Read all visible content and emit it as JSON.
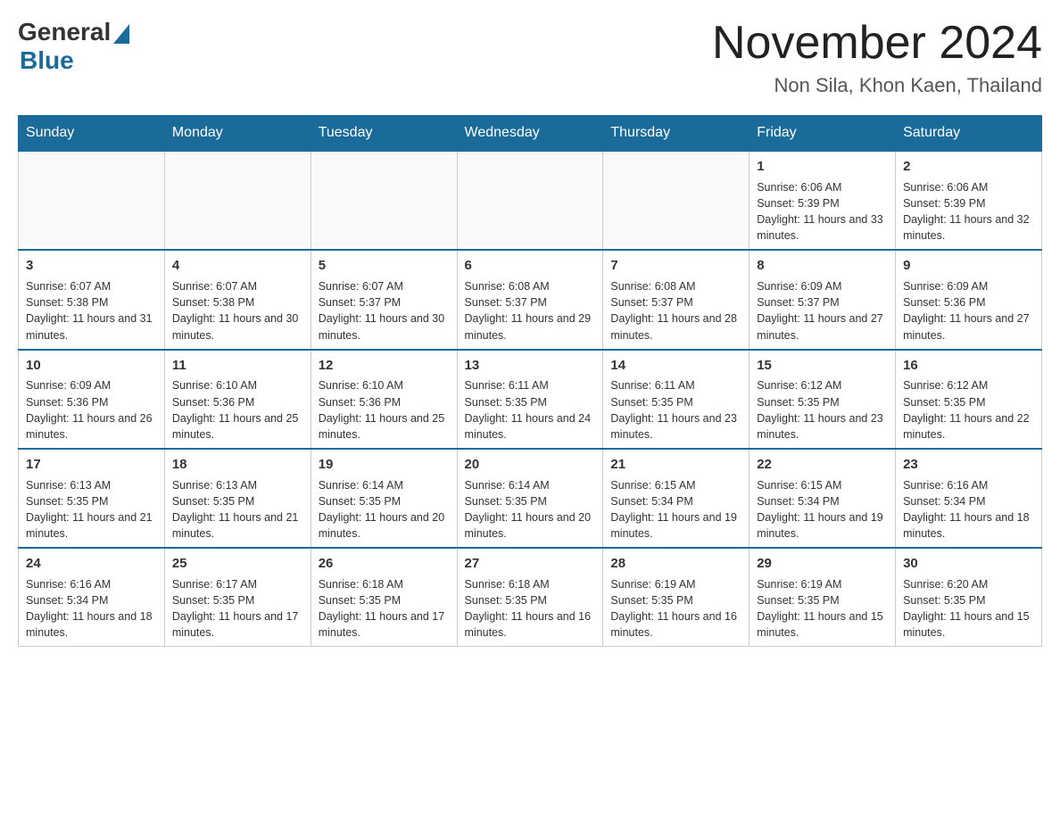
{
  "logo": {
    "general": "General",
    "blue": "Blue"
  },
  "title": "November 2024",
  "subtitle": "Non Sila, Khon Kaen, Thailand",
  "weekdays": [
    "Sunday",
    "Monday",
    "Tuesday",
    "Wednesday",
    "Thursday",
    "Friday",
    "Saturday"
  ],
  "weeks": [
    [
      {
        "day": "",
        "info": ""
      },
      {
        "day": "",
        "info": ""
      },
      {
        "day": "",
        "info": ""
      },
      {
        "day": "",
        "info": ""
      },
      {
        "day": "",
        "info": ""
      },
      {
        "day": "1",
        "info": "Sunrise: 6:06 AM\nSunset: 5:39 PM\nDaylight: 11 hours and 33 minutes."
      },
      {
        "day": "2",
        "info": "Sunrise: 6:06 AM\nSunset: 5:39 PM\nDaylight: 11 hours and 32 minutes."
      }
    ],
    [
      {
        "day": "3",
        "info": "Sunrise: 6:07 AM\nSunset: 5:38 PM\nDaylight: 11 hours and 31 minutes."
      },
      {
        "day": "4",
        "info": "Sunrise: 6:07 AM\nSunset: 5:38 PM\nDaylight: 11 hours and 30 minutes."
      },
      {
        "day": "5",
        "info": "Sunrise: 6:07 AM\nSunset: 5:37 PM\nDaylight: 11 hours and 30 minutes."
      },
      {
        "day": "6",
        "info": "Sunrise: 6:08 AM\nSunset: 5:37 PM\nDaylight: 11 hours and 29 minutes."
      },
      {
        "day": "7",
        "info": "Sunrise: 6:08 AM\nSunset: 5:37 PM\nDaylight: 11 hours and 28 minutes."
      },
      {
        "day": "8",
        "info": "Sunrise: 6:09 AM\nSunset: 5:37 PM\nDaylight: 11 hours and 27 minutes."
      },
      {
        "day": "9",
        "info": "Sunrise: 6:09 AM\nSunset: 5:36 PM\nDaylight: 11 hours and 27 minutes."
      }
    ],
    [
      {
        "day": "10",
        "info": "Sunrise: 6:09 AM\nSunset: 5:36 PM\nDaylight: 11 hours and 26 minutes."
      },
      {
        "day": "11",
        "info": "Sunrise: 6:10 AM\nSunset: 5:36 PM\nDaylight: 11 hours and 25 minutes."
      },
      {
        "day": "12",
        "info": "Sunrise: 6:10 AM\nSunset: 5:36 PM\nDaylight: 11 hours and 25 minutes."
      },
      {
        "day": "13",
        "info": "Sunrise: 6:11 AM\nSunset: 5:35 PM\nDaylight: 11 hours and 24 minutes."
      },
      {
        "day": "14",
        "info": "Sunrise: 6:11 AM\nSunset: 5:35 PM\nDaylight: 11 hours and 23 minutes."
      },
      {
        "day": "15",
        "info": "Sunrise: 6:12 AM\nSunset: 5:35 PM\nDaylight: 11 hours and 23 minutes."
      },
      {
        "day": "16",
        "info": "Sunrise: 6:12 AM\nSunset: 5:35 PM\nDaylight: 11 hours and 22 minutes."
      }
    ],
    [
      {
        "day": "17",
        "info": "Sunrise: 6:13 AM\nSunset: 5:35 PM\nDaylight: 11 hours and 21 minutes."
      },
      {
        "day": "18",
        "info": "Sunrise: 6:13 AM\nSunset: 5:35 PM\nDaylight: 11 hours and 21 minutes."
      },
      {
        "day": "19",
        "info": "Sunrise: 6:14 AM\nSunset: 5:35 PM\nDaylight: 11 hours and 20 minutes."
      },
      {
        "day": "20",
        "info": "Sunrise: 6:14 AM\nSunset: 5:35 PM\nDaylight: 11 hours and 20 minutes."
      },
      {
        "day": "21",
        "info": "Sunrise: 6:15 AM\nSunset: 5:34 PM\nDaylight: 11 hours and 19 minutes."
      },
      {
        "day": "22",
        "info": "Sunrise: 6:15 AM\nSunset: 5:34 PM\nDaylight: 11 hours and 19 minutes."
      },
      {
        "day": "23",
        "info": "Sunrise: 6:16 AM\nSunset: 5:34 PM\nDaylight: 11 hours and 18 minutes."
      }
    ],
    [
      {
        "day": "24",
        "info": "Sunrise: 6:16 AM\nSunset: 5:34 PM\nDaylight: 11 hours and 18 minutes."
      },
      {
        "day": "25",
        "info": "Sunrise: 6:17 AM\nSunset: 5:35 PM\nDaylight: 11 hours and 17 minutes."
      },
      {
        "day": "26",
        "info": "Sunrise: 6:18 AM\nSunset: 5:35 PM\nDaylight: 11 hours and 17 minutes."
      },
      {
        "day": "27",
        "info": "Sunrise: 6:18 AM\nSunset: 5:35 PM\nDaylight: 11 hours and 16 minutes."
      },
      {
        "day": "28",
        "info": "Sunrise: 6:19 AM\nSunset: 5:35 PM\nDaylight: 11 hours and 16 minutes."
      },
      {
        "day": "29",
        "info": "Sunrise: 6:19 AM\nSunset: 5:35 PM\nDaylight: 11 hours and 15 minutes."
      },
      {
        "day": "30",
        "info": "Sunrise: 6:20 AM\nSunset: 5:35 PM\nDaylight: 11 hours and 15 minutes."
      }
    ]
  ]
}
